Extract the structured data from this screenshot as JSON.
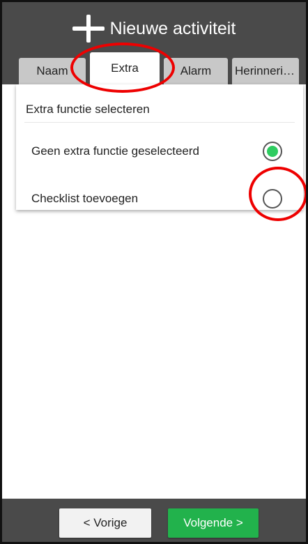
{
  "header": {
    "title": "Nieuwe activiteit",
    "icon": "plus-icon"
  },
  "tabs": [
    {
      "label": "Naam",
      "active": false
    },
    {
      "label": "Extra",
      "active": true
    },
    {
      "label": "Alarm",
      "active": false
    },
    {
      "label": "Herinneri…",
      "active": false
    }
  ],
  "card": {
    "title": "Extra functie selecteren",
    "options": [
      {
        "label": "Geen extra functie geselecteerd",
        "selected": true
      },
      {
        "label": "Checklist toevoegen",
        "selected": false
      }
    ]
  },
  "footer": {
    "prev_label": "< Vorige",
    "next_label": "Volgende >"
  },
  "colors": {
    "header_bg": "#4a4a4a",
    "accent_green": "#22b24c",
    "annotation_red": "#e00000"
  }
}
